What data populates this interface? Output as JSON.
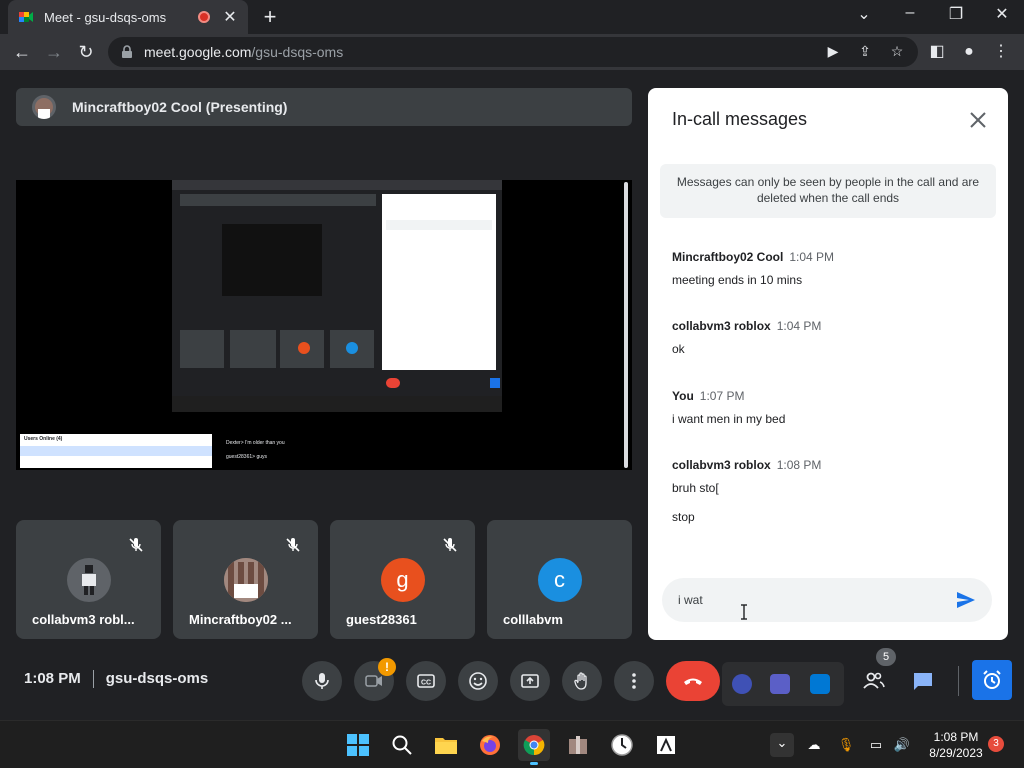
{
  "browser": {
    "tab_title": "Meet - gsu-dsqs-oms",
    "url_domain": "meet.google.com",
    "url_path": "/gsu-dsqs-oms"
  },
  "meet": {
    "presenter_label": "Mincraftboy02 Cool (Presenting)",
    "time": "1:08 PM",
    "meeting_code": "gsu-dsqs-oms",
    "participants_count": "5",
    "camera_badge": "!",
    "tiles": [
      {
        "name": "collabvm3 robl...",
        "initial": "",
        "color": "#5f6368"
      },
      {
        "name": "Mincraftboy02 ...",
        "initial": "",
        "color": "#8d6e63"
      },
      {
        "name": "guest28361",
        "initial": "g",
        "color": "#e8501e"
      },
      {
        "name": "colllabvm",
        "initial": "c",
        "color": "#1a8fe0"
      }
    ],
    "shared_screen": {
      "users_online": "Users Online (4)",
      "vm_chat": [
        "Dexter> I'm older than you",
        "guest28361> guys"
      ]
    }
  },
  "chat": {
    "title": "In-call messages",
    "notice": "Messages can only be seen by people in the call and are deleted when the call ends",
    "messages": [
      {
        "sender": "Mincraftboy02 Cool",
        "time": "1:04 PM",
        "lines": [
          "meeting ends in 10 mins"
        ]
      },
      {
        "sender": "collabvm3 roblox",
        "time": "1:04 PM",
        "lines": [
          "ok"
        ]
      },
      {
        "sender": "You",
        "time": "1:07 PM",
        "lines": [
          "i want men in my bed"
        ]
      },
      {
        "sender": "collabvm3 roblox",
        "time": "1:08 PM",
        "lines": [
          "bruh sto[",
          "stop"
        ]
      }
    ],
    "input_value": "i wat"
  },
  "taskbar": {
    "clock_time": "1:08 PM",
    "clock_date": "8/29/2023",
    "notifications": "3"
  },
  "colors": {
    "meet_bg": "#202124",
    "tile_bg": "#3c4043",
    "end_call": "#ea4335",
    "accent": "#1a73e8"
  }
}
